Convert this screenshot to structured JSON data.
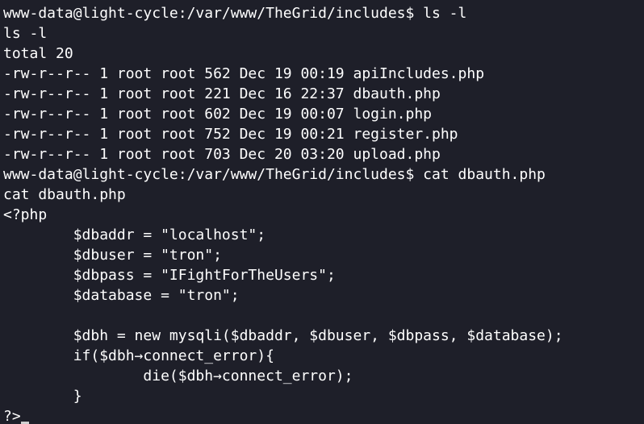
{
  "terminal": {
    "lines": [
      "www-data@light-cycle:/var/www/TheGrid/includes$ ls -l",
      "ls -l",
      "total 20",
      "-rw-r--r-- 1 root root 562 Dec 19 00:19 apiIncludes.php",
      "-rw-r--r-- 1 root root 221 Dec 16 22:37 dbauth.php",
      "-rw-r--r-- 1 root root 602 Dec 19 00:07 login.php",
      "-rw-r--r-- 1 root root 752 Dec 19 00:21 register.php",
      "-rw-r--r-- 1 root root 703 Dec 20 03:20 upload.php",
      "www-data@light-cycle:/var/www/TheGrid/includes$ cat dbauth.php",
      "cat dbauth.php",
      "<?php",
      "        $dbaddr = \"localhost\";",
      "        $dbuser = \"tron\";",
      "        $dbpass = \"IFightForTheUsers\";",
      "        $database = \"tron\";",
      "",
      "        $dbh = new mysqli($dbaddr, $dbuser, $dbpass, $database);",
      "        if($dbh→connect_error){",
      "                die($dbh→connect_error);",
      "        }",
      "?>"
    ]
  }
}
